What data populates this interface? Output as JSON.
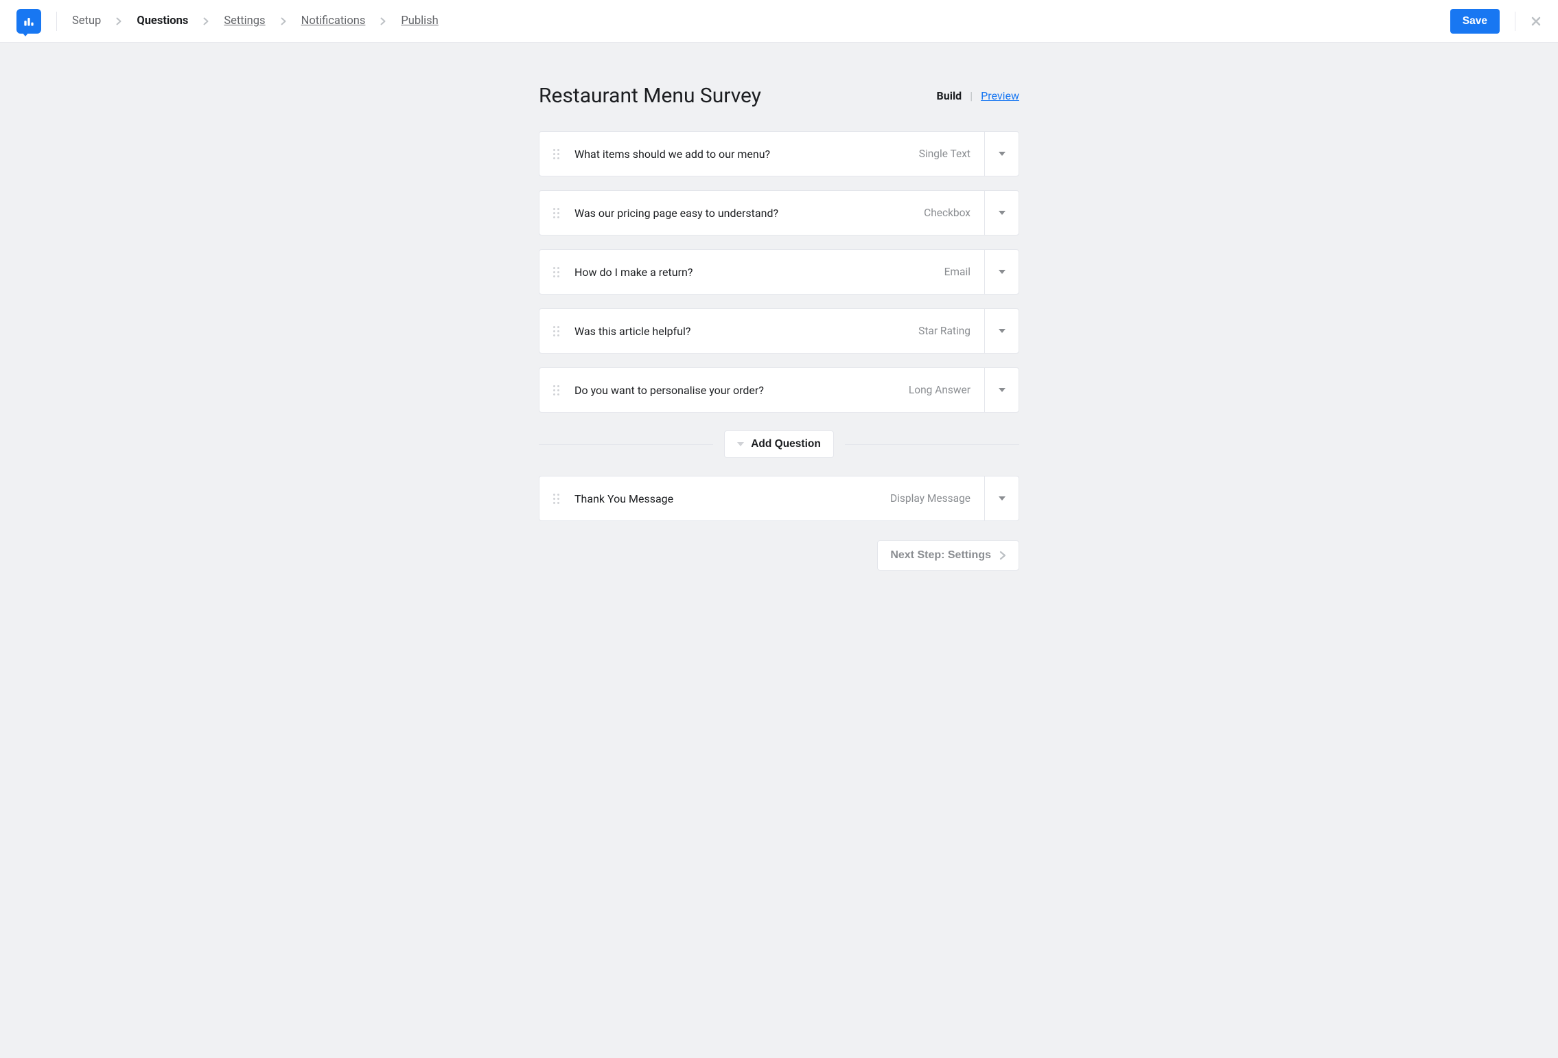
{
  "header": {
    "breadcrumbs": [
      {
        "label": "Setup",
        "active": false,
        "underline": false
      },
      {
        "label": "Questions",
        "active": true,
        "underline": false
      },
      {
        "label": "Settings",
        "active": false,
        "underline": true
      },
      {
        "label": "Notifications",
        "active": false,
        "underline": true
      },
      {
        "label": "Publish",
        "active": false,
        "underline": true
      }
    ],
    "save_label": "Save"
  },
  "page": {
    "title": "Restaurant Menu Survey",
    "view_toggle": {
      "build": "Build",
      "preview": "Preview"
    }
  },
  "questions": [
    {
      "text": "What items should we add to our menu?",
      "type": "Single Text"
    },
    {
      "text": "Was our pricing page easy to understand?",
      "type": "Checkbox"
    },
    {
      "text": "How do I make a return?",
      "type": "Email"
    },
    {
      "text": "Was this article helpful?",
      "type": "Star Rating"
    },
    {
      "text": "Do you want to personalise your order?",
      "type": "Long Answer"
    }
  ],
  "add_question_label": "Add Question",
  "footer_questions": [
    {
      "text": "Thank You Message",
      "type": "Display Message"
    }
  ],
  "next_step_label": "Next Step: Settings"
}
